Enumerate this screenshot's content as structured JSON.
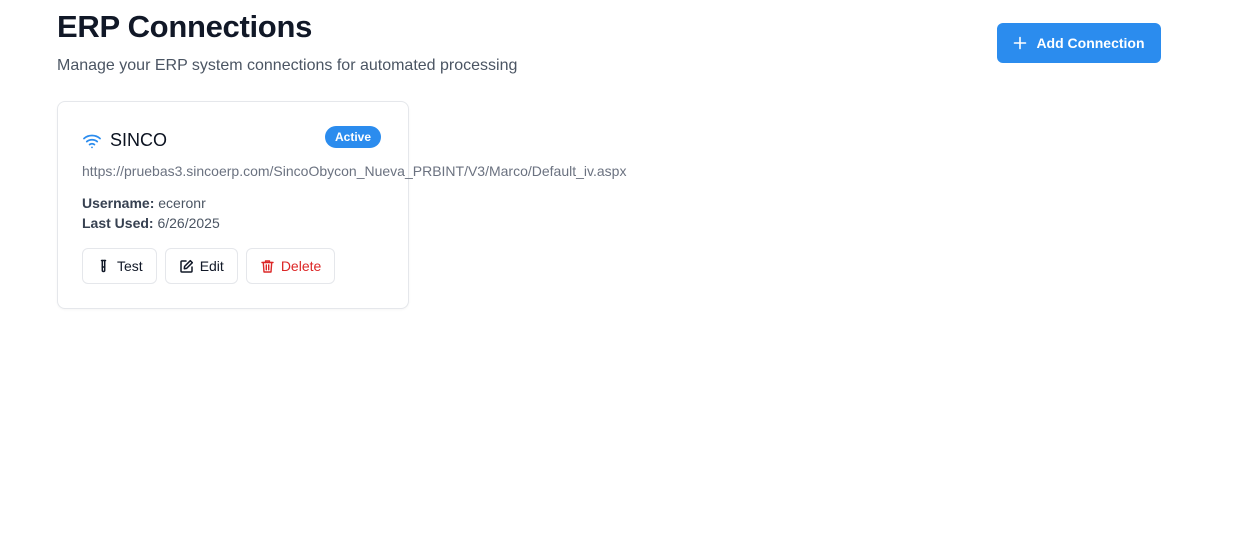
{
  "header": {
    "title": "ERP Connections",
    "subtitle": "Manage your ERP system connections for automated processing",
    "add_button_label": "Add Connection",
    "add_button_icon": "plus-icon"
  },
  "colors": {
    "accent": "#2b8cee",
    "danger": "#dc2626",
    "muted_text": "#6b7280"
  },
  "connections": [
    {
      "name": "SINCO",
      "icon": "wifi-icon",
      "status": "Active",
      "url": "https://pruebas3.sincoerp.com/SincoObycon_Nueva_PRBINT/V3/Marco/Default_iv.aspx",
      "username_label": "Username:",
      "username": "eceronr",
      "last_used_label": "Last Used:",
      "last_used": "6/26/2025",
      "actions": {
        "test": "Test",
        "edit": "Edit",
        "delete": "Delete"
      }
    }
  ]
}
